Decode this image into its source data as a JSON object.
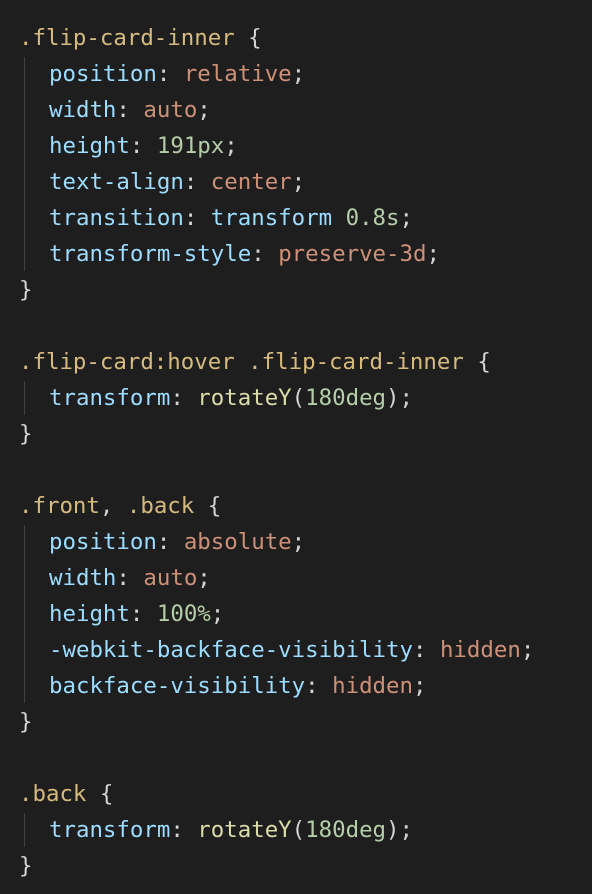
{
  "colors": {
    "background": "#1e1e1e",
    "selector": "#d7ba7d",
    "property": "#9cdcfe",
    "keyword_value": "#ce9178",
    "number": "#b5cea8",
    "function": "#dcdcaa",
    "punctuation": "#d4d4d4",
    "indent_guide": "#404040"
  },
  "code": {
    "l1": {
      "sel": ".flip-card-inner",
      "open": " {"
    },
    "l2": {
      "prop": "position",
      "sep": ": ",
      "val": "relative",
      "end": ";"
    },
    "l3": {
      "prop": "width",
      "sep": ": ",
      "val": "auto",
      "end": ";"
    },
    "l4": {
      "prop": "height",
      "sep": ": ",
      "num": "191px",
      "end": ";"
    },
    "l5": {
      "prop": "text-align",
      "sep": ": ",
      "val": "center",
      "end": ";"
    },
    "l6": {
      "prop": "transition",
      "sep": ": ",
      "val": "transform",
      "sp": " ",
      "num": "0.8s",
      "end": ";"
    },
    "l7": {
      "prop": "transform-style",
      "sep": ": ",
      "val": "preserve-3d",
      "end": ";"
    },
    "l8": {
      "close": "}"
    },
    "l10": {
      "sel1": ".flip-card:hover",
      "sp": " ",
      "sel2": ".flip-card-inner",
      "open": " {"
    },
    "l11": {
      "prop": "transform",
      "sep": ": ",
      "fn": "rotateY",
      "lp": "(",
      "num": "180deg",
      "rp": ")",
      "end": ";"
    },
    "l12": {
      "close": "}"
    },
    "l14": {
      "sel1": ".front",
      "comma": ", ",
      "sel2": ".back",
      "open": " {"
    },
    "l15": {
      "prop": "position",
      "sep": ": ",
      "val": "absolute",
      "end": ";"
    },
    "l16": {
      "prop": "width",
      "sep": ": ",
      "val": "auto",
      "end": ";"
    },
    "l17": {
      "prop": "height",
      "sep": ": ",
      "num": "100%",
      "end": ";"
    },
    "l18": {
      "prop": "-webkit-backface-visibility",
      "sep": ": ",
      "val": "hidden",
      "end": ";"
    },
    "l19": {
      "prop": "backface-visibility",
      "sep": ": ",
      "val": "hidden",
      "end": ";"
    },
    "l20": {
      "close": "}"
    },
    "l22": {
      "sel": ".back",
      "open": " {"
    },
    "l23": {
      "prop": "transform",
      "sep": ": ",
      "fn": "rotateY",
      "lp": "(",
      "num": "180deg",
      "rp": ")",
      "end": ";"
    },
    "l24": {
      "close": "}"
    }
  }
}
